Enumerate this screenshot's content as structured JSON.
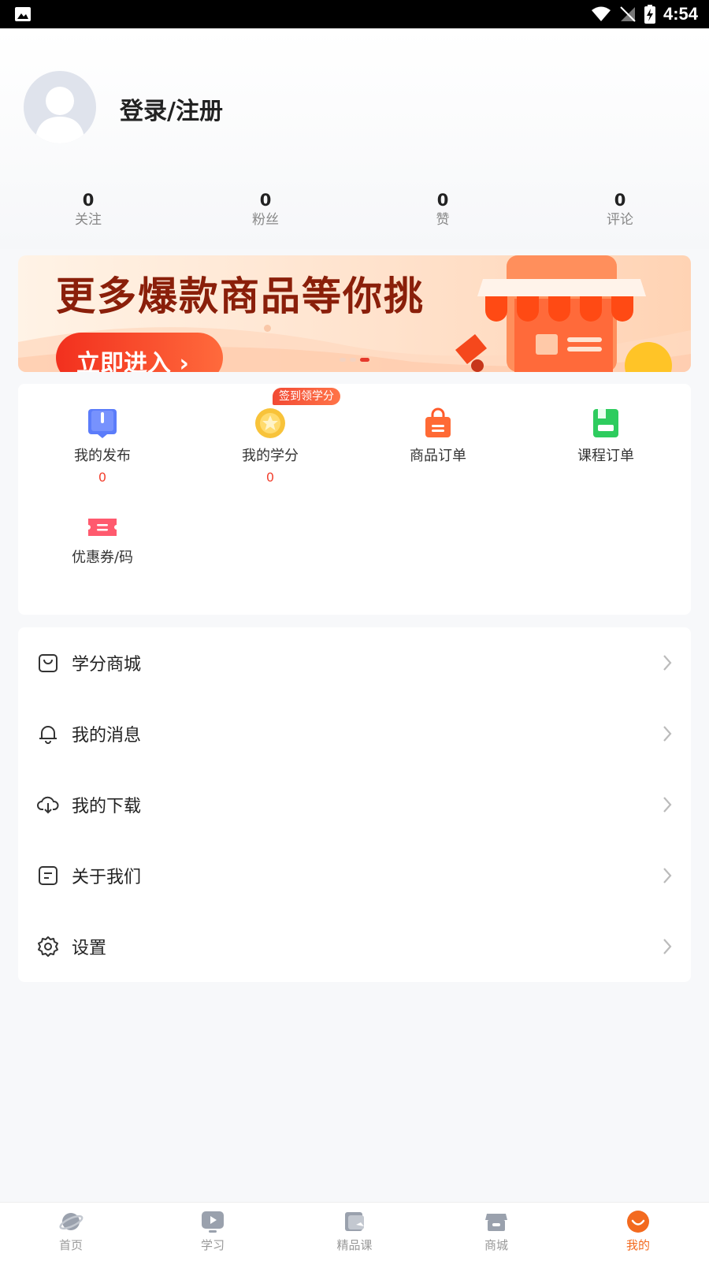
{
  "status_bar": {
    "time": "4:54"
  },
  "profile": {
    "login_label": "登录/注册",
    "stats": [
      {
        "value": "0",
        "label": "关注"
      },
      {
        "value": "0",
        "label": "粉丝"
      },
      {
        "value": "0",
        "label": "赞"
      },
      {
        "value": "0",
        "label": "评论"
      }
    ]
  },
  "banner": {
    "title": "更多爆款商品等你挑",
    "button_label": "立即进入 ›",
    "active_slide": 3,
    "slide_count": 3
  },
  "shortcuts": {
    "sign_badge": "签到领学分",
    "items": [
      {
        "label": "我的发布",
        "count": "0",
        "icon": "publish-icon",
        "color": "#4f7dff"
      },
      {
        "label": "我的学分",
        "count": "0",
        "icon": "coin-icon",
        "color": "#f8b82c"
      },
      {
        "label": "商品订单",
        "count": "",
        "icon": "shopping-bag-icon",
        "color": "#ff5a2a"
      },
      {
        "label": "课程订单",
        "count": "",
        "icon": "course-order-icon",
        "color": "#22c55e"
      },
      {
        "label": "优惠券/码",
        "count": "",
        "icon": "coupon-icon",
        "color": "#ff4d63"
      }
    ]
  },
  "menu": {
    "items": [
      {
        "label": "学分商城",
        "icon": "shopping-bag-outline-icon"
      },
      {
        "label": "我的消息",
        "icon": "bell-icon"
      },
      {
        "label": "我的下载",
        "icon": "cloud-download-icon"
      },
      {
        "label": "关于我们",
        "icon": "document-icon"
      },
      {
        "label": "设置",
        "icon": "gear-icon"
      }
    ]
  },
  "tabbar": {
    "active_index": 4,
    "tabs": [
      {
        "label": "首页",
        "icon": "planet-icon"
      },
      {
        "label": "学习",
        "icon": "play-icon"
      },
      {
        "label": "精品课",
        "icon": "wallet-icon"
      },
      {
        "label": "商城",
        "icon": "store-icon"
      },
      {
        "label": "我的",
        "icon": "user-face-icon"
      }
    ]
  },
  "colors": {
    "accent": "#f36a1f",
    "count_red": "#f2412f",
    "banner_red": "#e5392b"
  }
}
